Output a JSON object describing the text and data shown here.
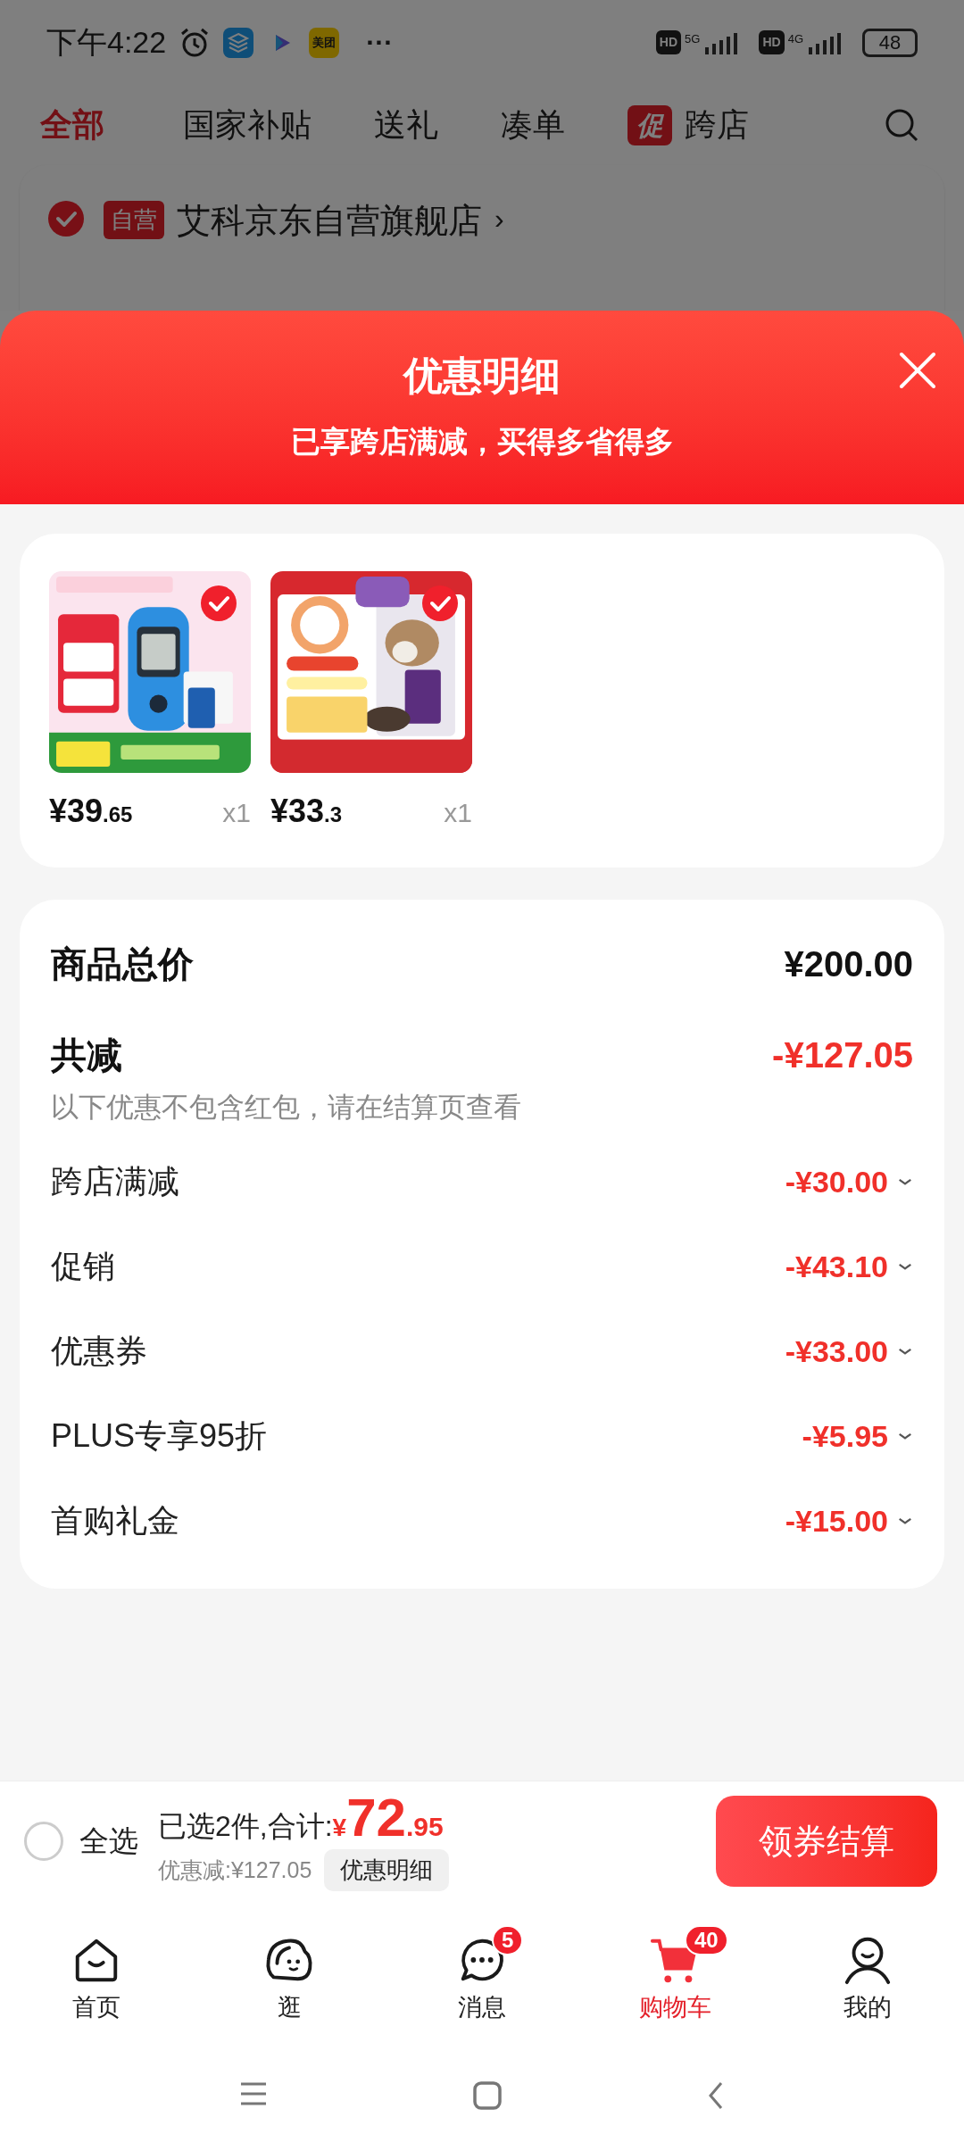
{
  "status_bar": {
    "time": "下午4:22",
    "app_icons": [
      {
        "kind": "layers"
      },
      {
        "kind": "play"
      },
      {
        "kind": "meituan",
        "label": "美团"
      }
    ],
    "more": "···",
    "network": [
      {
        "hd": "HD",
        "gen": "5G"
      },
      {
        "hd": "HD",
        "gen": "4G"
      }
    ],
    "battery": "48"
  },
  "tabs": [
    {
      "label": "国家补贴",
      "selected": false
    },
    {
      "label": "送礼",
      "selected": false
    },
    {
      "label": "凑单",
      "selected": false
    },
    {
      "label": "跨店",
      "selected": false,
      "badge": "促"
    }
  ],
  "first_tab": {
    "label": "全部",
    "selected": true
  },
  "store": {
    "checked": true,
    "badge": "自营",
    "name": "艾科京东自营旗舰店",
    "chevron": "›"
  },
  "sheet": {
    "title": "优惠明细",
    "subtitle": "已享跨店满减，买得多省得多"
  },
  "products": [
    {
      "kind": "glucose",
      "selected": true,
      "price_main": "¥39",
      "price_cents": ".65",
      "qty": "x1"
    },
    {
      "kind": "catfood",
      "selected": true,
      "price_main": "¥33",
      "price_cents": ".3",
      "qty": "x1"
    }
  ],
  "summary": {
    "total_label": "商品总价",
    "total_value": "¥200.00",
    "reduce_label": "共减",
    "reduce_value": "-¥127.05",
    "note": "以下优惠不包含红包，请在结算页查看"
  },
  "discounts": [
    {
      "label": "跨店满减",
      "value": "-¥30.00"
    },
    {
      "label": "促销",
      "value": "-¥43.10"
    },
    {
      "label": "优惠券",
      "value": "-¥33.00"
    },
    {
      "label": "PLUS专享95折",
      "value": "-¥5.95"
    },
    {
      "label": "首购礼金",
      "value": "-¥15.00"
    }
  ],
  "checkout": {
    "select_all": "全选",
    "select_all_checked": false,
    "selected_text": "已选2件,合计:",
    "currency": "¥",
    "amount_main": "72",
    "amount_cents": ".95",
    "saved": "优惠减:¥127.05",
    "detail_button": "优惠明细",
    "pay_button": "领券结算"
  },
  "nav": [
    {
      "kind": "home",
      "label": "首页",
      "selected": false
    },
    {
      "kind": "explore",
      "label": "逛",
      "selected": false
    },
    {
      "kind": "message",
      "label": "消息",
      "selected": false,
      "badge": "5"
    },
    {
      "kind": "cart",
      "label": "购物车",
      "selected": true,
      "badge": "40"
    },
    {
      "kind": "me",
      "label": "我的",
      "selected": false
    }
  ]
}
